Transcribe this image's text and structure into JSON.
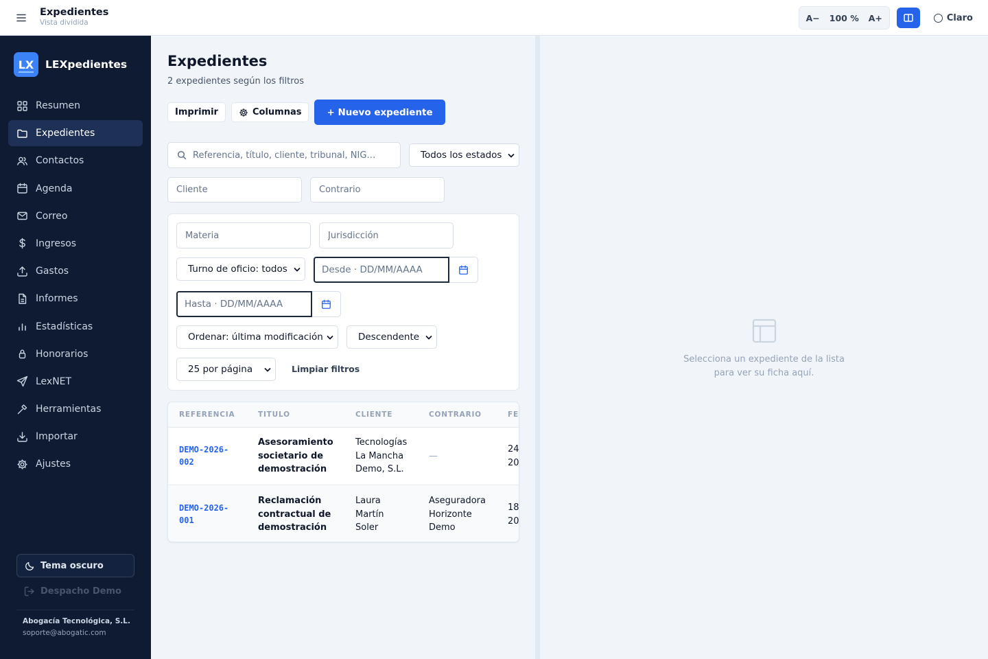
{
  "topbar": {
    "title": "Expedientes",
    "subtitle": "Vista dividida",
    "zoom_out": "A−",
    "zoom_level": "100 %",
    "zoom_in": "A+",
    "theme_label": "Claro"
  },
  "sidebar": {
    "brand_logo": "LX",
    "brand_name": "LEXpedientes",
    "items": [
      {
        "label": "Resumen",
        "icon": "grid-icon"
      },
      {
        "label": "Expedientes",
        "icon": "folder-icon",
        "active": true
      },
      {
        "label": "Contactos",
        "icon": "users-icon"
      },
      {
        "label": "Agenda",
        "icon": "calendar-icon"
      },
      {
        "label": "Correo",
        "icon": "mail-icon"
      },
      {
        "label": "Ingresos",
        "icon": "dollar-icon"
      },
      {
        "label": "Gastos",
        "icon": "upload-icon"
      },
      {
        "label": "Informes",
        "icon": "file-text-icon"
      },
      {
        "label": "Estadísticas",
        "icon": "bar-chart-icon"
      },
      {
        "label": "Honorarios",
        "icon": "lock-icon"
      },
      {
        "label": "LexNET",
        "icon": "send-icon"
      },
      {
        "label": "Herramientas",
        "icon": "hammer-icon"
      },
      {
        "label": "Importar",
        "icon": "download-icon"
      },
      {
        "label": "Ajustes",
        "icon": "gear-icon"
      }
    ],
    "dark_theme_label": "Tema oscuro",
    "logout_label": "Despacho Demo",
    "company": "Abogacía Tecnológica, S.L.",
    "email": "soporte@abogatic.com"
  },
  "list": {
    "title": "Expedientes",
    "subtitle": "2 expedientes según los filtros",
    "print_label": "Imprimir",
    "columns_label": "Columnas",
    "new_label": "+ Nuevo expediente",
    "search_placeholder": "Referencia, título, cliente, tribunal, NIG…",
    "status_select": "Todos los estados",
    "client_placeholder": "Cliente",
    "opponent_placeholder": "Contrario",
    "subject_placeholder": "Materia",
    "jurisdiction_placeholder": "Jurisdicción",
    "duty_select": "Turno de oficio: todos",
    "from_placeholder": "Desde · DD/MM/AAAA",
    "to_placeholder": "Hasta · DD/MM/AAAA",
    "order_select": "Ordenar: última modificación",
    "direction_select": "Descendente",
    "per_page_select": "25 por página",
    "clear_filters": "Limpiar filtros",
    "columns": [
      "REFERENCIA",
      "TITULO",
      "CLIENTE",
      "CONTRARIO",
      "FE"
    ],
    "rows": [
      {
        "ref": [
          "DEMO-2026-",
          "002"
        ],
        "title": [
          "Asesoramiento",
          "societario de",
          "demostración"
        ],
        "client": [
          "Tecnologías",
          "La Mancha",
          "Demo, S.L."
        ],
        "opponent": [
          "—"
        ],
        "date": [
          "24",
          "20"
        ]
      },
      {
        "ref": [
          "DEMO-2026-",
          "001"
        ],
        "title": [
          "Reclamación",
          "contractual de",
          "demostración"
        ],
        "client": [
          "Laura",
          "Martín",
          "Soler"
        ],
        "opponent": [
          "Aseguradora",
          "Horizonte",
          "Demo"
        ],
        "date": [
          "18",
          "20"
        ]
      }
    ]
  },
  "detail": {
    "empty_line1": "Selecciona un expediente de la lista",
    "empty_line2": "para ver su ficha aquí."
  },
  "colors": {
    "accent": "#2563eb",
    "sidebar_bg": "#0f1b33",
    "sidebar_active": "#1e3056"
  }
}
